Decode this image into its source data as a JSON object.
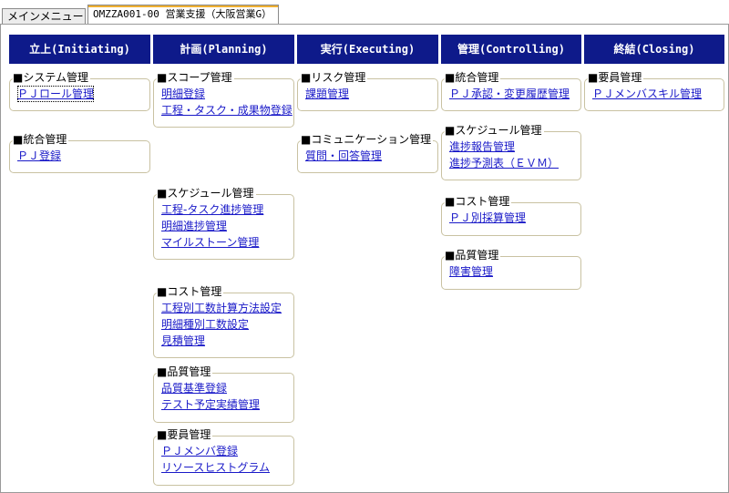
{
  "tabs": {
    "main_menu": "メインメニュー",
    "active": "OMZZA001-00 営業支援（大阪営業G）"
  },
  "phases": [
    {
      "label": "立上(Initiating)"
    },
    {
      "label": "計画(Planning)"
    },
    {
      "label": "実行(Executing)"
    },
    {
      "label": "管理(Controlling)"
    },
    {
      "label": "終結(Closing)"
    }
  ],
  "groups": {
    "initiating_system": {
      "title": "■システム管理",
      "links": [
        "ＰＪロール管理"
      ]
    },
    "initiating_integration": {
      "title": "■統合管理",
      "links": [
        "ＰＪ登録"
      ]
    },
    "planning_scope": {
      "title": "■スコープ管理",
      "links": [
        "明細登録",
        "工程・タスク・成果物登録"
      ]
    },
    "planning_schedule": {
      "title": "■スケジュール管理",
      "links": [
        "工程-タスク進捗管理",
        "明細進捗管理",
        "マイルストーン管理"
      ]
    },
    "planning_cost": {
      "title": "■コスト管理",
      "links": [
        "工程別工数計算方法設定",
        "明細種別工数設定",
        "見積管理"
      ]
    },
    "planning_quality": {
      "title": "■品質管理",
      "links": [
        "品質基準登録",
        "テスト予定実績管理"
      ]
    },
    "planning_staff": {
      "title": "■要員管理",
      "links": [
        "ＰＪメンバ登録",
        "リソースヒストグラム"
      ]
    },
    "executing_risk": {
      "title": "■リスク管理",
      "links": [
        "課題管理"
      ]
    },
    "executing_comm": {
      "title": "■コミュニケーション管理",
      "links": [
        "質問・回答管理"
      ]
    },
    "controlling_integration": {
      "title": "■統合管理",
      "links": [
        "ＰＪ承認・変更履歴管理"
      ]
    },
    "controlling_schedule": {
      "title": "■スケジュール管理",
      "links": [
        "進捗報告管理",
        "進捗予測表（ＥＶＭ）"
      ]
    },
    "controlling_cost": {
      "title": "■コスト管理",
      "links": [
        "ＰＪ別採算管理"
      ]
    },
    "controlling_quality": {
      "title": "■品質管理",
      "links": [
        "障害管理"
      ]
    },
    "closing_staff": {
      "title": "■要員管理",
      "links": [
        "ＰＪメンバスキル管理"
      ]
    }
  }
}
